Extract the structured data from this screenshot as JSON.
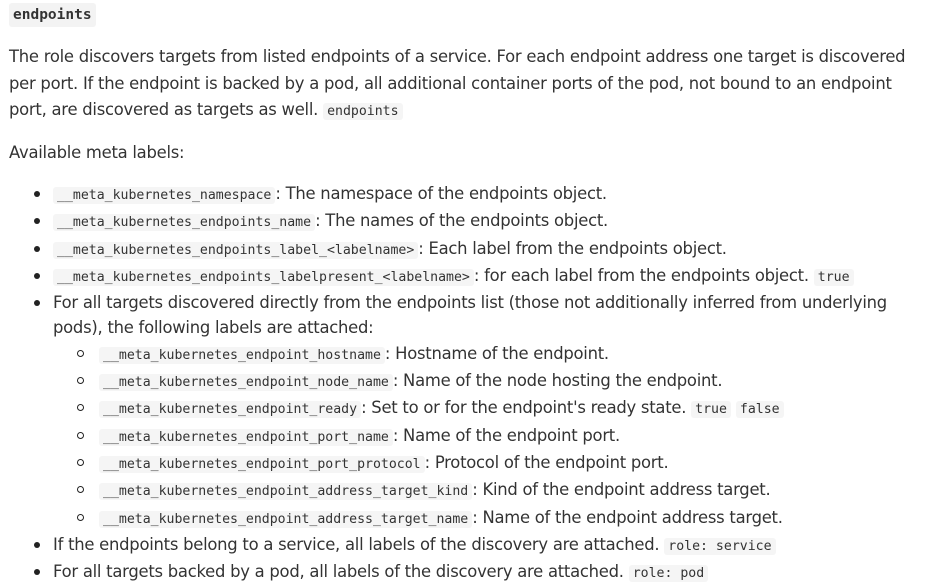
{
  "heading": "endpoints",
  "intro": {
    "text": "The role discovers targets from listed endpoints of a service. For each endpoint address one target is discovered per port. If the endpoint is backed by a pod, all additional container ports of the pod, not bound to an endpoint port, are discovered as targets as well.",
    "code": "endpoints"
  },
  "meta_title": "Available meta labels:",
  "items": [
    {
      "code": "__meta_kubernetes_namespace",
      "text": ": The namespace of the endpoints object."
    },
    {
      "code": "__meta_kubernetes_endpoints_name",
      "text": ": The names of the endpoints object."
    },
    {
      "code": "__meta_kubernetes_endpoints_label_<labelname>",
      "text": ": Each label from the endpoints object."
    },
    {
      "code": "__meta_kubernetes_endpoints_labelpresent_<labelname>",
      "text": ": for each label from the endpoints object.",
      "code2": "true"
    },
    {
      "text": "For all targets discovered directly from the endpoints list (those not additionally inferred from underlying pods), the following labels are attached:",
      "sub": [
        {
          "code": "__meta_kubernetes_endpoint_hostname",
          "text": ": Hostname of the endpoint."
        },
        {
          "code": "__meta_kubernetes_endpoint_node_name",
          "text": ": Name of the node hosting the endpoint."
        },
        {
          "code": "__meta_kubernetes_endpoint_ready",
          "text": ": Set to or for the endpoint's ready state.",
          "code2": "true",
          "code3": "false"
        },
        {
          "code": "__meta_kubernetes_endpoint_port_name",
          "text": ": Name of the endpoint port."
        },
        {
          "code": "__meta_kubernetes_endpoint_port_protocol",
          "text": ": Protocol of the endpoint port."
        },
        {
          "code": "__meta_kubernetes_endpoint_address_target_kind",
          "text": ": Kind of the endpoint address target."
        },
        {
          "code": "__meta_kubernetes_endpoint_address_target_name",
          "text": ": Name of the endpoint address target."
        }
      ]
    },
    {
      "text": "If the endpoints belong to a service, all labels of the discovery are attached.",
      "code2": "role: service"
    },
    {
      "text": "For all targets backed by a pod, all labels of the discovery are attached.",
      "code2": "role: pod"
    }
  ]
}
